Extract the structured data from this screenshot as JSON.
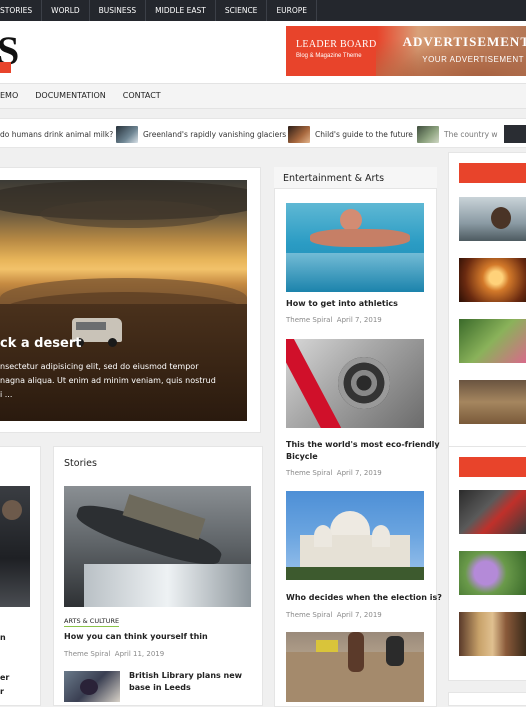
{
  "topbar": {
    "items": [
      "STORIES",
      "WORLD",
      "BUSINESS",
      "MIDDLE EAST",
      "SCIENCE",
      "EUROPE"
    ]
  },
  "header": {
    "logo_letter": "S",
    "ad": {
      "title": "LEADER BOARD",
      "subtitle": "Blog & Magazine Theme",
      "right_title": "ADVERTISEMENT",
      "right_subtitle": "YOUR ADVERTISEMENT"
    }
  },
  "nav": {
    "items": [
      "EMO",
      "DOCUMENTATION",
      "CONTACT"
    ]
  },
  "ticker": {
    "items": [
      {
        "text": "do humans drink animal milk?",
        "color": ""
      },
      {
        "text": "Greenland's rapidly vanishing glaciers",
        "color": "#4a5a66"
      },
      {
        "text": "Child's guide to the future",
        "color": "#7a4a3a"
      },
      {
        "text": "The country w",
        "color": "#5a6a5a"
      }
    ]
  },
  "hero": {
    "title": "ck a desert",
    "excerpt_lines": [
      "nsectetur adipisicing elit, sed do eiusmod tempor",
      "nagna aliqua. Ut enim ad minim veniam, quis nostrud",
      "i ..."
    ]
  },
  "entertainment": {
    "title": "Entertainment & Arts",
    "posts": [
      {
        "title": "How to get into athletics",
        "author": "Theme Spiral",
        "date": "April 7, 2019"
      },
      {
        "title_lines": [
          "This the world's most eco-friendly",
          "Bicycle"
        ],
        "author": "Theme Spiral",
        "date": "April 7, 2019"
      },
      {
        "title": "Who decides when the election is?",
        "author": "Theme Spiral",
        "date": "April 7, 2019"
      }
    ]
  },
  "stories": {
    "title": "Stories",
    "category": "ARTS & CULTURE",
    "main_post": {
      "title": "How you can think yourself thin",
      "author": "Theme Spiral",
      "date": "April 11, 2019"
    },
    "small_post": {
      "title_lines": [
        "British Library plans new",
        "base in Leeds"
      ]
    }
  },
  "left_partial": {
    "lines": [
      "n",
      "er",
      "r"
    ]
  },
  "colors": {
    "accent": "#e8442b",
    "dark": "#24272d",
    "tag_underline": "#8bc34a"
  }
}
